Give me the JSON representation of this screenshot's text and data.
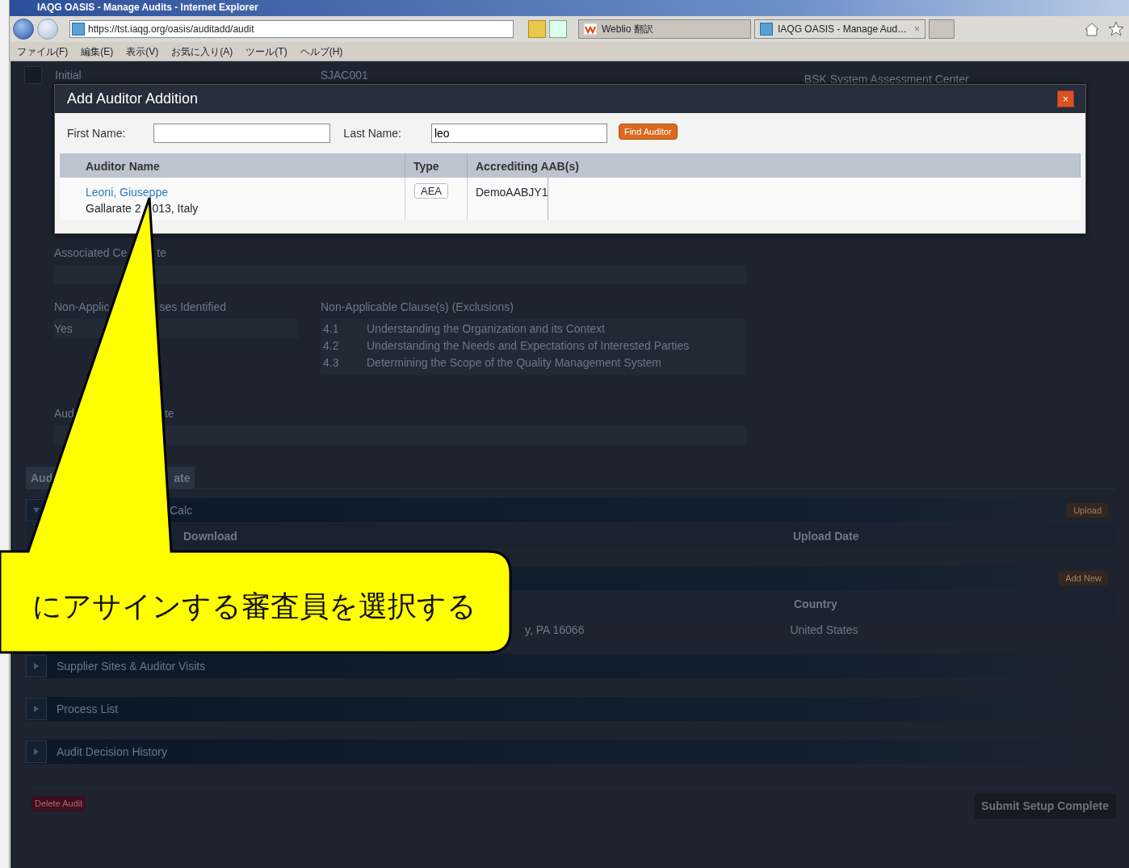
{
  "browser": {
    "title": "IAQG OASIS - Manage Audits - Internet Explorer",
    "address": "https://tst.iaqg.org/oasis/auditadd/audit",
    "tabs": [
      {
        "label": "Weblio 翻訳",
        "selected": false
      },
      {
        "label": "IAQG OASIS - Manage Aud…",
        "selected": true,
        "close": "×"
      }
    ],
    "menu": [
      "ファイル(F)",
      "編集(E)",
      "表示(V)",
      "お気に入り(A)",
      "ツール(T)",
      "ヘルプ(H)"
    ]
  },
  "page": {
    "header": {
      "status": "Initial",
      "code": "SJAC001",
      "organization": "BSK System Assessment Center"
    },
    "associated": {
      "label_parts": [
        "Associated Ce",
        "te"
      ]
    },
    "non_applicable": {
      "label_parts": [
        "Non-Applic",
        "ses Identified"
      ],
      "value": "Yes"
    },
    "exclusions": {
      "label": "Non-Applicable Clause(s) (Exclusions)",
      "clauses": [
        {
          "number": "4.1",
          "title": "Understanding the Organization and its Context"
        },
        {
          "number": "4.2",
          "title": "Understanding the Needs and Expectations of Interested Parties"
        },
        {
          "number": "4.3",
          "title": "Determining the Scope of the Quality Management System"
        }
      ]
    },
    "audit_field": {
      "label_parts": [
        "Aud",
        "te"
      ]
    },
    "tab": {
      "label_parts": [
        "Aud",
        "ate"
      ],
      "selected": true
    },
    "calc_section": {
      "title": "Calc",
      "button": "Upload",
      "columns": [
        "Download",
        "Upload Date"
      ]
    },
    "site_section": {
      "button": "Add New",
      "columns": [
        "",
        "Country"
      ],
      "rows": [
        [
          "y, PA 16066",
          "United States"
        ]
      ]
    },
    "sections": [
      {
        "title": "Supplier Sites & Auditor Visits",
        "expanded": false
      },
      {
        "title": "Process List",
        "expanded": false
      },
      {
        "title": "Audit Decision History",
        "expanded": false
      }
    ],
    "delete_button": "Delete Audit",
    "submit_button": "Submit Setup Complete"
  },
  "modal": {
    "title": "Add Auditor Addition",
    "close": "×",
    "first_name": {
      "label": "First Name:"
    },
    "last_name": {
      "label": "Last Name:",
      "value": "leo"
    },
    "find_button": "Find Auditor",
    "columns": [
      "Auditor Name",
      "Type",
      "Accrediting AAB(s)"
    ],
    "rows": [
      {
        "name": "Leoni, Giuseppe",
        "location_parts": [
          "Gallarate 2",
          "013, Italy"
        ],
        "type": "AEA",
        "aab": "DemoAABJY1"
      }
    ]
  },
  "callout": {
    "text": "にアサインする審査員を選択する"
  }
}
